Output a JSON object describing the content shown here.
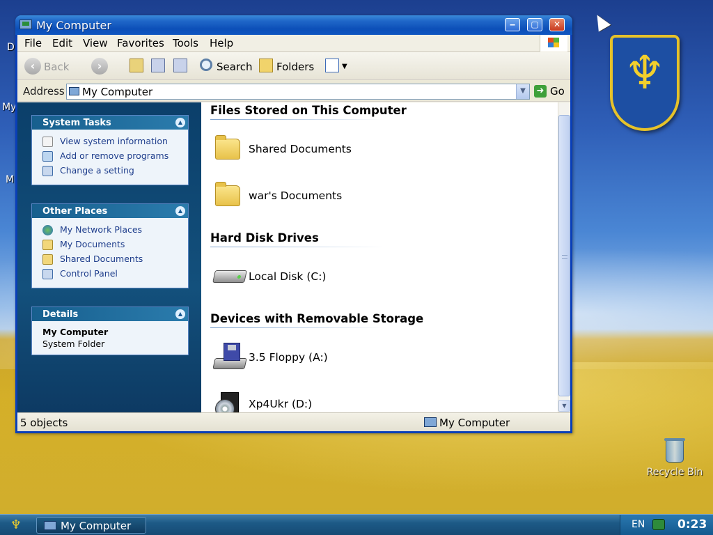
{
  "window": {
    "title": "My Computer",
    "buttons": {
      "minimize": "‒",
      "maximize": "▢",
      "close": "✕"
    }
  },
  "menubar": {
    "items": [
      "File",
      "Edit",
      "View",
      "Favorites",
      "Tools",
      "Help"
    ]
  },
  "toolbar": {
    "back_label": "Back",
    "search_label": "Search",
    "folders_label": "Folders"
  },
  "address": {
    "label": "Address",
    "value": "My Computer",
    "go_label": "Go"
  },
  "taskpane": {
    "system_tasks": {
      "title": "System Tasks",
      "items": [
        "View system information",
        "Add or remove programs",
        "Change a setting"
      ]
    },
    "other_places": {
      "title": "Other Places",
      "items": [
        "My Network Places",
        "My Documents",
        "Shared Documents",
        "Control Panel"
      ]
    },
    "details": {
      "title": "Details",
      "name": "My Computer",
      "type": "System Folder"
    }
  },
  "content": {
    "groups": [
      {
        "title": "Files Stored on This Computer",
        "items": [
          "Shared Documents",
          "war's Documents"
        ]
      },
      {
        "title": "Hard Disk Drives",
        "items": [
          "Local Disk (C:)"
        ]
      },
      {
        "title": "Devices with Removable Storage",
        "items": [
          "3.5 Floppy (A:)",
          "Xp4Ukr (D:)"
        ]
      }
    ]
  },
  "statusbar": {
    "objects": "5 objects",
    "location": "My Computer"
  },
  "desktop": {
    "recycle_bin": "Recycle Bin",
    "fragments": [
      "D",
      "My",
      "M"
    ]
  },
  "taskbar": {
    "task_label": "My Computer",
    "language": "EN",
    "clock": "0:23"
  },
  "colors": {
    "xp_blue": "#0a46d0",
    "link_blue": "#1f3e8c",
    "panel_head": "#175f8e",
    "ukraine_gold": "#f2cf2c"
  }
}
